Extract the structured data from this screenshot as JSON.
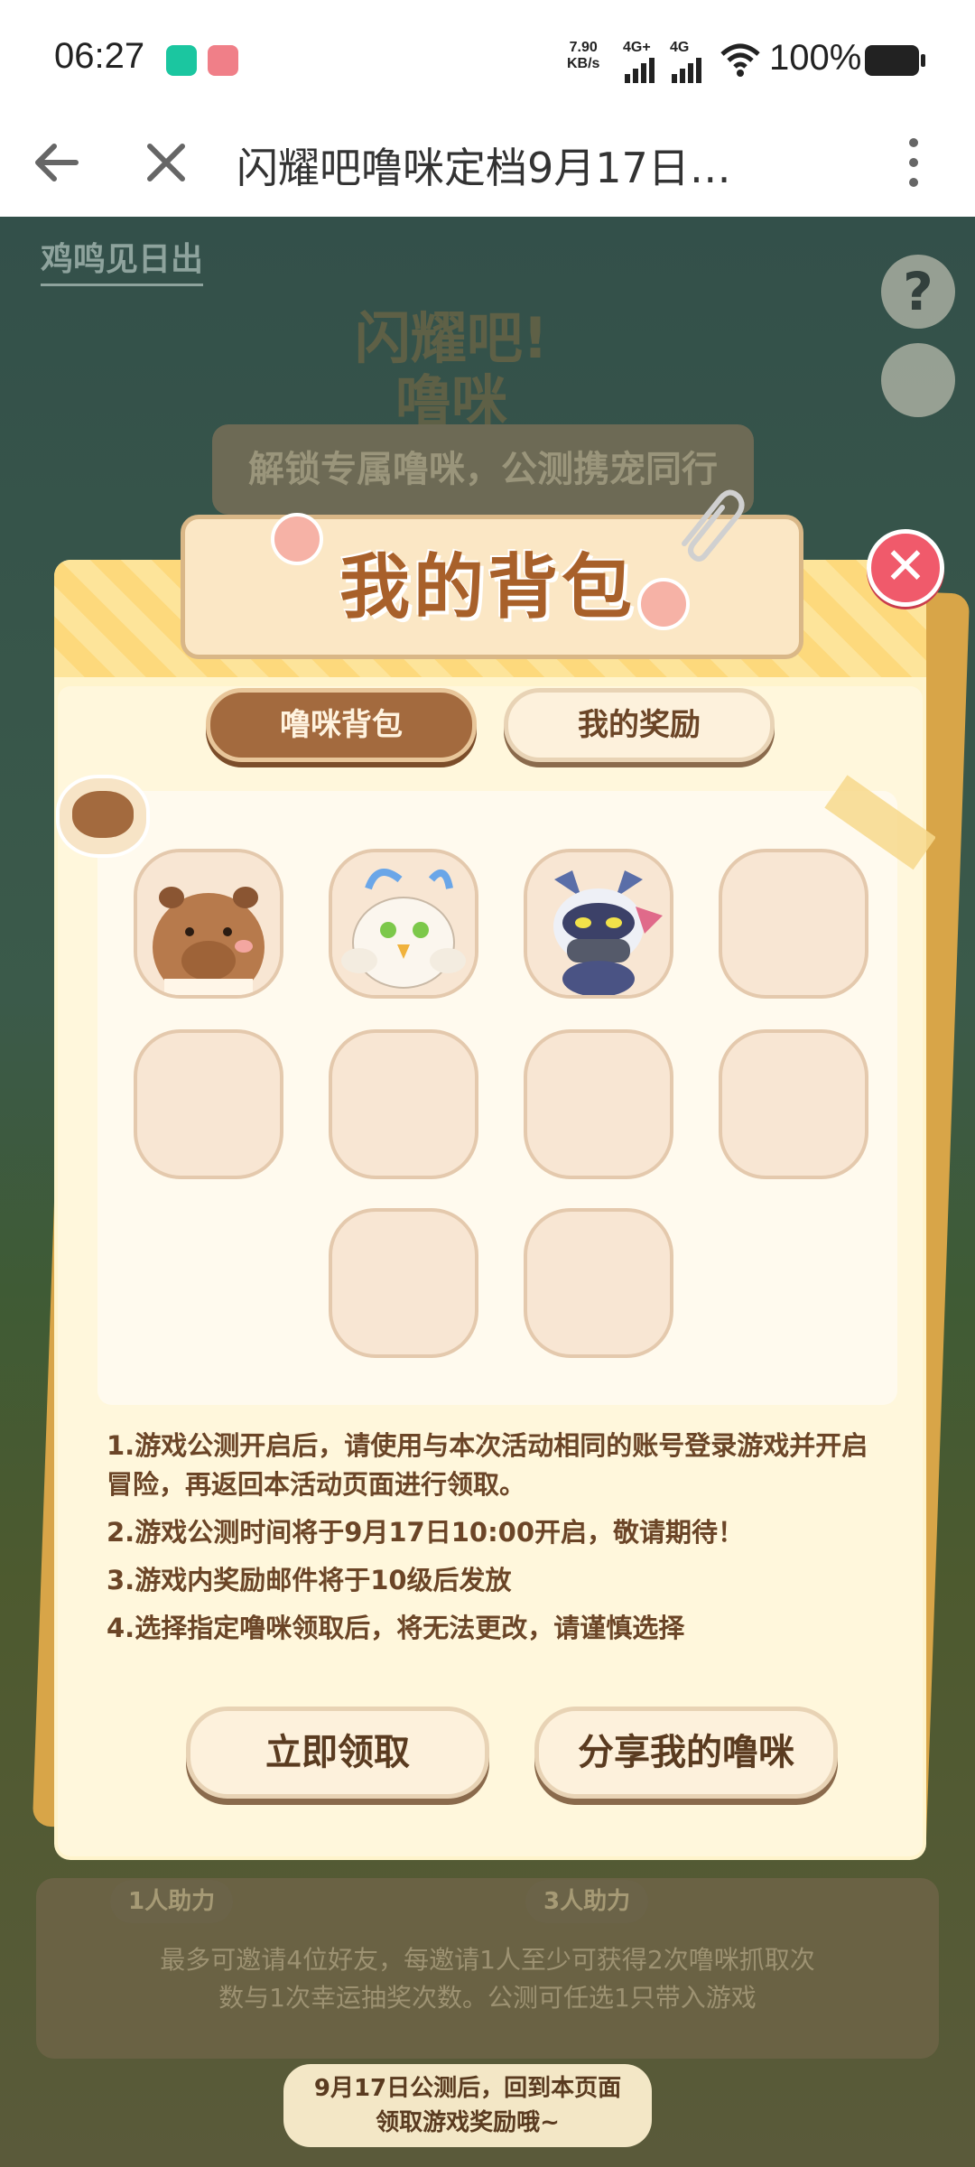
{
  "status_bar": {
    "time": "06:27",
    "net_speed_value": "7.90",
    "net_speed_unit": "KB/s",
    "signal_1": "4G+",
    "signal_2": "4G",
    "battery": "100%"
  },
  "nav": {
    "title": "闪耀吧噜咪定档9月17日…",
    "back_icon": "back-arrow-icon",
    "close_icon": "close-icon",
    "more_icon": "more-vertical-icon"
  },
  "background": {
    "header_title": "鸡鸣见日出",
    "logo_text_1": "闪耀吧!",
    "logo_text_2": "噜咪",
    "banner": "解锁专属噜咪，公测携宠同行",
    "help": "?",
    "helper_1": "1人助力",
    "helper_3": "3人助力",
    "invite_text": "最多可邀请4位好友，每邀请1人至少可获得2次噜咪抓取次数与1次幸运抽奖次数。公测可任选1只带入游戏",
    "bubble_line1": "9月17日公测后，回到本页面",
    "bubble_line2": "领取游戏奖励哦~"
  },
  "modal": {
    "title": "我的背包",
    "close": "✕",
    "tabs": [
      {
        "label": "噜咪背包",
        "active": true
      },
      {
        "label": "我的奖励",
        "active": false
      }
    ],
    "slots": [
      {
        "pet": "capybara"
      },
      {
        "pet": "white-bird"
      },
      {
        "pet": "masked-dragon"
      },
      {
        "pet": ""
      },
      {
        "pet": ""
      },
      {
        "pet": ""
      },
      {
        "pet": ""
      },
      {
        "pet": ""
      },
      {
        "pet": ""
      },
      {
        "pet": ""
      }
    ],
    "rules": [
      "1.游戏公测开启后，请使用与本次活动相同的账号登录游戏并开启冒险，再返回本活动页面进行领取。",
      "2.游戏公测时间将于9月17日10:00开启，敬请期待！",
      "3.游戏内奖励邮件将于10级后发放",
      "4.选择指定噜咪领取后，将无法更改，请谨慎选择"
    ],
    "buttons": {
      "claim": "立即领取",
      "share": "分享我的噜咪"
    }
  },
  "colors": {
    "accent_brown": "#a36a3e",
    "modal_bg": "#fff4cc",
    "close_red": "#f05a6b"
  }
}
